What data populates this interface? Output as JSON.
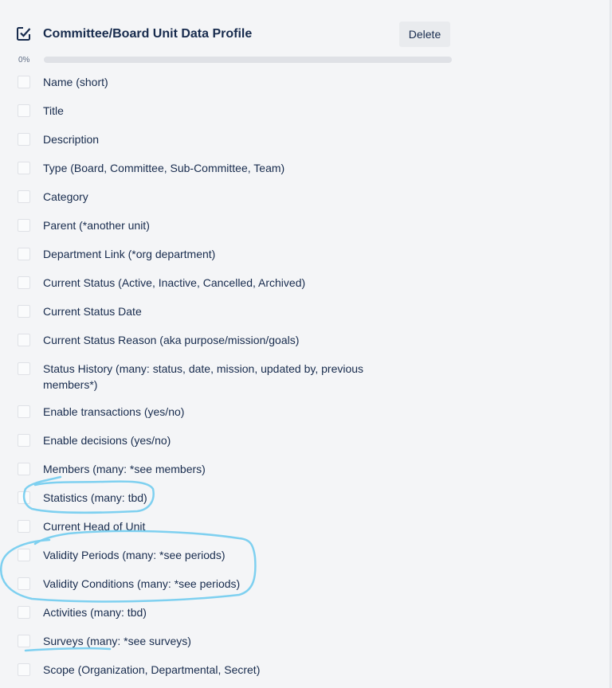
{
  "checklist": {
    "title": "Committee/Board Unit Data Profile",
    "delete_label": "Delete",
    "progress_text": "0%",
    "progress_fraction": 0,
    "icon": "checkbox-checked-icon",
    "items": [
      {
        "label": "Name (short)",
        "checked": false
      },
      {
        "label": "Title",
        "checked": false
      },
      {
        "label": "Description",
        "checked": false
      },
      {
        "label": "Type (Board, Committee, Sub-Committee, Team)",
        "checked": false
      },
      {
        "label": "Category",
        "checked": false
      },
      {
        "label": "Parent (*another unit)",
        "checked": false
      },
      {
        "label": "Department Link (*org department)",
        "checked": false
      },
      {
        "label": "Current Status (Active, Inactive, Cancelled, Archived)",
        "checked": false
      },
      {
        "label": "Current Status Date",
        "checked": false
      },
      {
        "label": "Current Status Reason (aka purpose/mission/goals)",
        "checked": false
      },
      {
        "label": "Status History (many: status, date, mission, updated by, previous members*)",
        "checked": false
      },
      {
        "label": "Enable transactions (yes/no)",
        "checked": false
      },
      {
        "label": "Enable decisions (yes/no)",
        "checked": false
      },
      {
        "label": "Members (many: *see members)",
        "checked": false
      },
      {
        "label": "Statistics (many: tbd)",
        "checked": false
      },
      {
        "label": "Current Head of Unit",
        "checked": false
      },
      {
        "label": "Validity Periods (many: *see periods)",
        "checked": false
      },
      {
        "label": "Validity Conditions (many: *see periods)",
        "checked": false
      },
      {
        "label": "Activities (many: tbd)",
        "checked": false
      },
      {
        "label": "Surveys (many: *see surveys)",
        "checked": false
      },
      {
        "label": "Scope (Organization, Departmental, Secret)",
        "checked": false
      }
    ]
  },
  "annotations": {
    "stroke_color": "#7ed0f0"
  }
}
